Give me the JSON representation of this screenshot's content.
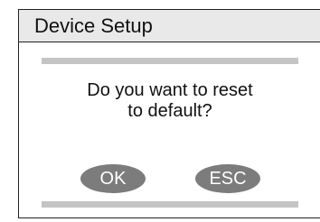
{
  "window": {
    "title": "Device Setup"
  },
  "dialog": {
    "message_line1": "Do you want to reset",
    "message_line2": "to default?",
    "ok_label": "OK",
    "esc_label": "ESC"
  },
  "colors": {
    "title_bar_bg": "#e9e9e9",
    "dialog_frame": "#c4c4c4",
    "button_bg": "#7c7c7c",
    "button_text": "#ffffff"
  }
}
